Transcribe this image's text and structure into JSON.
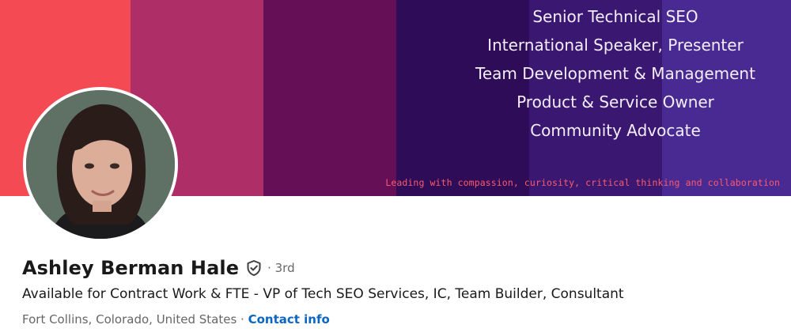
{
  "banner": {
    "colors": [
      "#f44a54",
      "#ae2e68",
      "#650f56",
      "#2e0c58",
      "#3a1872",
      "#482a92"
    ],
    "taglines": [
      "Senior Technical SEO",
      "International Speaker, Presenter",
      "Team Development & Management",
      "Product & Service Owner",
      "Community Advocate"
    ],
    "motto": "Leading with compassion, curiosity, critical thinking and collaboration"
  },
  "profile": {
    "name": "Ashley Berman Hale",
    "verified_icon": "shield-check-icon",
    "degree": "· 3rd",
    "headline": "Available for Contract Work & FTE - VP of Tech SEO Services, IC, Team Builder, Consultant",
    "location": "Fort Collins, Colorado, United States",
    "separator": " · ",
    "contact_label": "Contact info"
  },
  "colors": {
    "link": "#0a66c2",
    "name": "#191919",
    "muted": "#666666"
  }
}
